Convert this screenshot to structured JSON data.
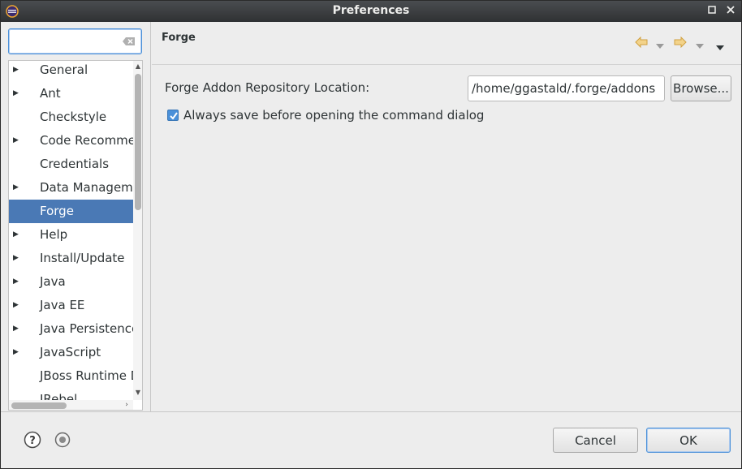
{
  "window": {
    "title": "Preferences"
  },
  "filter": {
    "value": "",
    "placeholder": ""
  },
  "tree": {
    "items": [
      {
        "label": "General",
        "expandable": true
      },
      {
        "label": "Ant",
        "expandable": true
      },
      {
        "label": "Checkstyle",
        "expandable": false
      },
      {
        "label": "Code Recommenders",
        "expandable": true
      },
      {
        "label": "Credentials",
        "expandable": false
      },
      {
        "label": "Data Management",
        "expandable": true
      },
      {
        "label": "Forge",
        "expandable": false,
        "selected": true
      },
      {
        "label": "Help",
        "expandable": true
      },
      {
        "label": "Install/Update",
        "expandable": true
      },
      {
        "label": "Java",
        "expandable": true
      },
      {
        "label": "Java EE",
        "expandable": true
      },
      {
        "label": "Java Persistence",
        "expandable": true
      },
      {
        "label": "JavaScript",
        "expandable": true
      },
      {
        "label": "JBoss Runtime Detection",
        "expandable": false
      },
      {
        "label": "JRebel",
        "expandable": false
      }
    ]
  },
  "page": {
    "title": "Forge",
    "repo_label": "Forge Addon Repository Location:",
    "repo_value": "/home/ggastald/.forge/addons",
    "browse_label": "Browse...",
    "always_save_label": "Always save before opening the command dialog",
    "always_save_checked": true
  },
  "buttons": {
    "cancel": "Cancel",
    "ok": "OK"
  },
  "icons": {
    "app": "eclipse-icon",
    "minimize": "minimize-icon",
    "close": "close-icon",
    "clear": "clear-text-icon",
    "back": "back-arrow-icon",
    "forward": "forward-arrow-icon",
    "menu": "view-menu-icon",
    "help": "help-icon",
    "import": "import-export-icon"
  },
  "colors": {
    "selection": "#4a79b5",
    "accent": "#4a90d9",
    "nav_arrow": "#e6b84a"
  }
}
